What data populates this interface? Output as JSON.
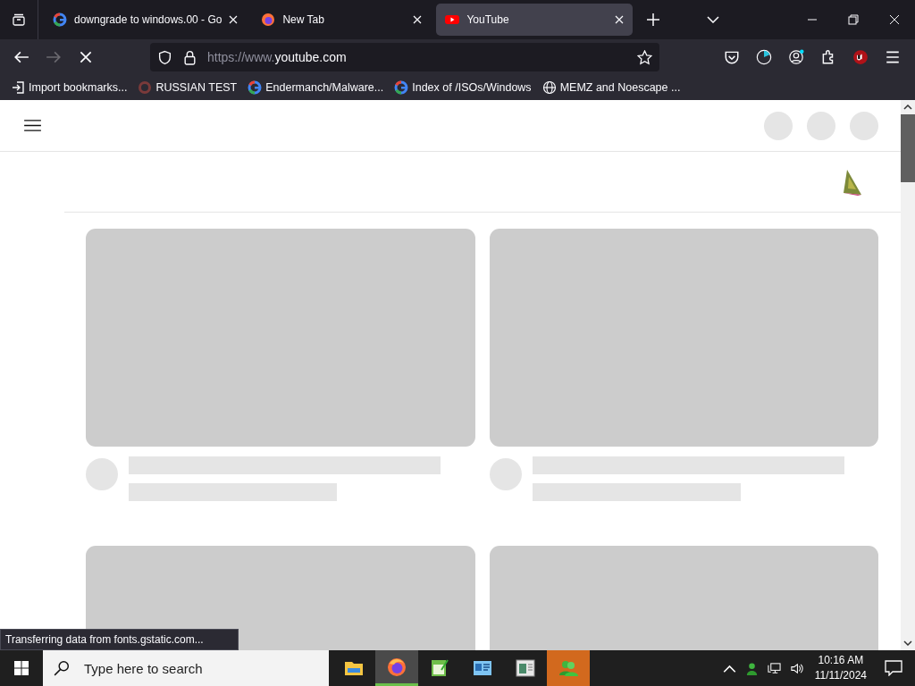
{
  "tabs": [
    {
      "title": "downgrade to windows.00 - Go",
      "selected": false
    },
    {
      "title": "New Tab",
      "selected": false
    },
    {
      "title": "YouTube",
      "selected": true
    }
  ],
  "address": {
    "prefix": "https://www.",
    "domain": "youtube.com"
  },
  "bookmarks": [
    {
      "label": "Import bookmarks..."
    },
    {
      "label": "RUSSIAN TEST"
    },
    {
      "label": "Endermanch/Malware..."
    },
    {
      "label": "Index of /ISOs/Windows"
    },
    {
      "label": "MEMZ and Noescape ..."
    }
  ],
  "page": {
    "videos": [
      {
        "kind": "skeleton"
      },
      {
        "kind": "skeleton"
      },
      {
        "kind": "skeleton"
      },
      {
        "kind": "skeleton"
      }
    ]
  },
  "status_text": "Transferring data from fonts.gstatic.com...",
  "taskbar": {
    "search_placeholder": "Type here to search",
    "apps": [
      {
        "selected": false,
        "attention": false
      },
      {
        "selected": true,
        "attention": false
      },
      {
        "selected": false,
        "attention": false
      },
      {
        "selected": false,
        "attention": false
      },
      {
        "selected": false,
        "attention": false
      },
      {
        "selected": false,
        "attention": true
      }
    ],
    "time": "10:16 AM",
    "date": "11/11/2024"
  }
}
